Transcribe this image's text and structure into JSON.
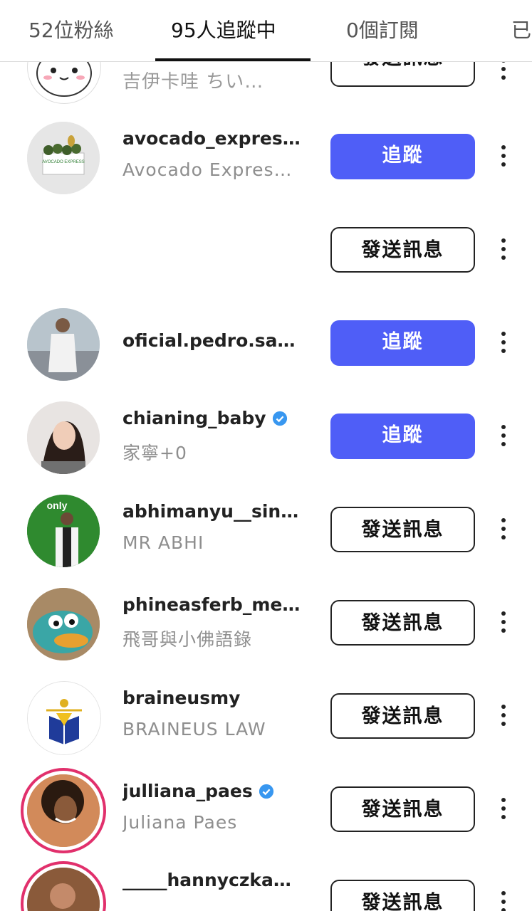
{
  "tabs": [
    {
      "label": "52位粉絲"
    },
    {
      "label": "95人追蹤中"
    },
    {
      "label": "0個訂閱"
    },
    {
      "label": "已"
    }
  ],
  "buttons": {
    "follow": "追蹤",
    "message": "發送訊息"
  },
  "colors": {
    "follow_bg": "#4f5ef7",
    "verified": "#3897f0",
    "ring": "#e1306c"
  },
  "rows": [
    {
      "username": "",
      "display": "吉伊卡哇 ちい…",
      "action": "發送訊息"
    },
    {
      "username": "avocado_expres…",
      "display": "Avocado Expres…",
      "action": "追蹤"
    },
    {
      "username": "",
      "display": "",
      "action": "發送訊息"
    },
    {
      "username": "oficial.pedro.sa…",
      "display": "",
      "action": "追蹤"
    },
    {
      "username": "chianing_baby",
      "display": "家寧+0",
      "action": "追蹤",
      "verified": true
    },
    {
      "username": "abhimanyu__sin…",
      "display": "MR ABHI",
      "action": "發送訊息"
    },
    {
      "username": "phineasferb_me…",
      "display": "飛哥與小佛語錄",
      "action": "發送訊息"
    },
    {
      "username": "braineusmy",
      "display": "BRAINEUS LAW",
      "action": "發送訊息"
    },
    {
      "username": "julliana_paes",
      "display": "Juliana Paes",
      "action": "發送訊息",
      "verified": true
    },
    {
      "username": "_____hannyczka…",
      "display": "",
      "action": "發送訊息"
    }
  ],
  "avatar_text": {
    "avocado": "AVOCADO EXPRESS",
    "abhimanyu": "only"
  }
}
